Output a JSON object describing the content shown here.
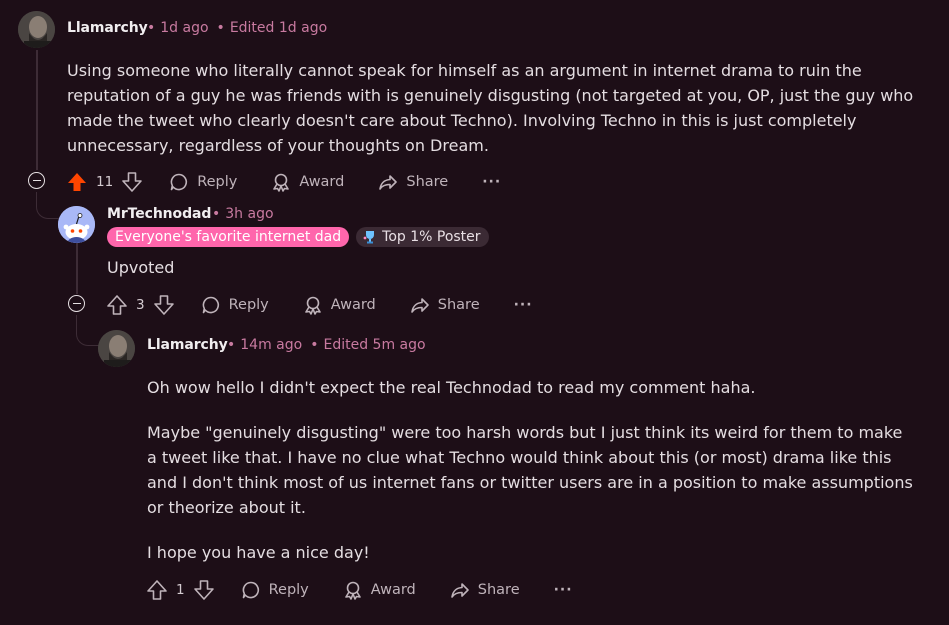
{
  "comments": [
    {
      "author": "Llamarchy",
      "time": "1d ago",
      "edited": "Edited 1d ago",
      "body": [
        "Using someone who literally cannot speak for himself as an argument in internet drama to ruin the reputation of a guy he was friends with is genuinely disgusting (not targeted at you, OP, just the guy who made the tweet who clearly doesn't care about Techno). Involving Techno in this is just completely unnecessary, regardless of your thoughts on Dream."
      ],
      "votes": "11",
      "upvoted": true
    },
    {
      "author": "MrTechnodad",
      "time": "3h ago",
      "flairs": [
        "Everyone's favorite internet dad",
        "Top 1% Poster"
      ],
      "body": [
        "Upvoted"
      ],
      "votes": "3",
      "upvoted": false
    },
    {
      "author": "Llamarchy",
      "time": "14m ago",
      "edited": "Edited 5m ago",
      "body": [
        "Oh wow hello I didn't expect the real Technodad to read my comment haha.",
        "Maybe \"genuinely disgusting\" were too harsh words but I just think its weird for them to make a tweet like that. I have no clue what Techno would think about this (or most) drama like this and I don't think most of us internet fans or twitter users are in a position to make assumptions or theorize about it.",
        "I hope you have a nice day!"
      ],
      "votes": "1",
      "upvoted": false
    }
  ],
  "actions": {
    "reply": "Reply",
    "award": "Award",
    "share": "Share",
    "more": "···"
  },
  "icons": {
    "upvote": "arrow-up-icon",
    "downvote": "arrow-down-icon",
    "reply": "speech-bubble-icon",
    "award": "award-icon",
    "share": "share-arrow-icon",
    "collapse": "minus-circle-icon",
    "flair": "trophy-icon"
  },
  "colors": {
    "upvoted": "#ff4500",
    "flair_pink": "#ff66ac",
    "meta": "#c87aa0",
    "background": "#1d0e17"
  }
}
